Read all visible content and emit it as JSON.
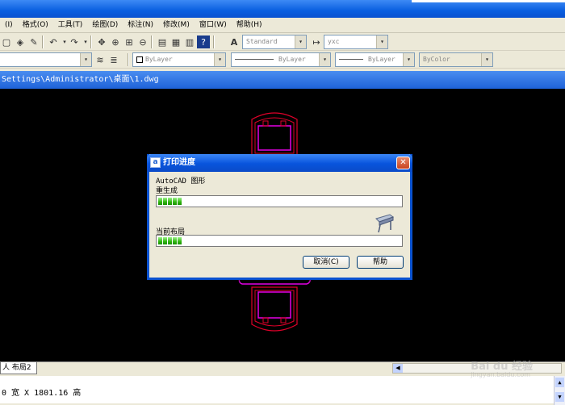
{
  "menu": [
    "(I)",
    "格式(O)",
    "工具(T)",
    "绘图(D)",
    "标注(N)",
    "修改(M)",
    "窗口(W)",
    "帮助(H)"
  ],
  "toolbar": {
    "text_style": "Standard",
    "dim_style": "yxc",
    "layer_color": "ByLayer",
    "linetype": "ByLayer",
    "lineweight": "ByLayer",
    "plot_style": "ByColor"
  },
  "path": "Settings\\Administrator\\桌面\\1.dwg",
  "tabs": {
    "layout2": "人 布局2"
  },
  "command_line": "0 宽 X 1801.16 高",
  "dialog": {
    "title": "打印进度",
    "app_line": "AutoCAD 图形",
    "regen_label": "重生成",
    "regen_progress": 0.1,
    "layout_label": "当前布局",
    "layout_progress": 0.1,
    "cancel_button": "取消(C)",
    "help_button": "帮助"
  },
  "watermark": {
    "brand": "Bai du 经验",
    "url": "jingyan.baidu.com"
  },
  "colors": {
    "accent": "#0a52d0",
    "canvas": "#000000",
    "drawing_red": "#e0002a",
    "drawing_magenta": "#e600e6"
  }
}
